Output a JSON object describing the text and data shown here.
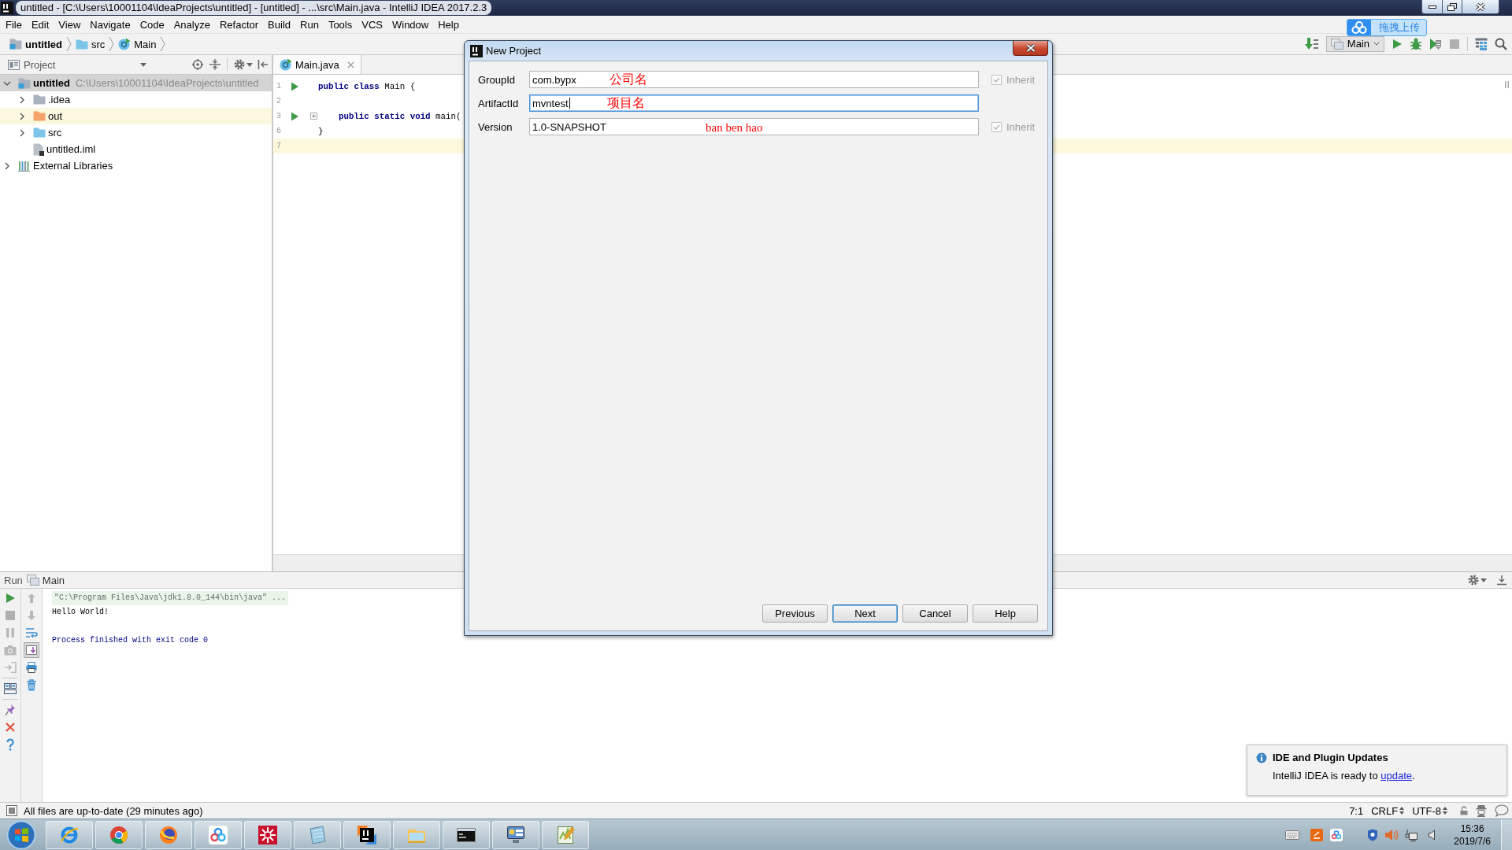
{
  "window": {
    "title": "untitled - [C:\\Users\\10001104\\IdeaProjects\\untitled] - [untitled] - ...\\src\\Main.java - IntelliJ IDEA 2017.2.3"
  },
  "menu": [
    "File",
    "Edit",
    "View",
    "Navigate",
    "Code",
    "Analyze",
    "Refactor",
    "Build",
    "Run",
    "Tools",
    "VCS",
    "Window",
    "Help"
  ],
  "breadcrumb": [
    {
      "label": "untitled",
      "kind": "project"
    },
    {
      "label": "src",
      "kind": "source-folder"
    },
    {
      "label": "Main",
      "kind": "class"
    }
  ],
  "toolbar": {
    "run_config": "Main"
  },
  "upload_widget": {
    "label": "拖拽上传"
  },
  "project_panel": {
    "title": "Project",
    "tree": [
      {
        "label": "untitled",
        "kind": "project",
        "path": "C:\\Users\\10001104\\IdeaProjects\\untitled",
        "expanded": true,
        "selected": true,
        "highlighted": false,
        "children": [
          {
            "label": ".idea",
            "kind": "folder",
            "expanded": false,
            "selected": false,
            "highlighted": false
          },
          {
            "label": "out",
            "kind": "excluded-folder",
            "expanded": false,
            "selected": false,
            "highlighted": true
          },
          {
            "label": "src",
            "kind": "source-folder",
            "expanded": false,
            "selected": false,
            "highlighted": false
          },
          {
            "label": "untitled.iml",
            "kind": "module-file",
            "selected": false,
            "highlighted": false
          }
        ]
      },
      {
        "label": "External Libraries",
        "kind": "libraries",
        "expanded": false,
        "selected": false,
        "highlighted": false
      }
    ]
  },
  "editor": {
    "tabs": [
      {
        "label": "Main.java",
        "selected": true
      }
    ],
    "lines": [
      {
        "number": "1",
        "code": "**public** **class** Main {",
        "run_marker": true,
        "fold_marker": false,
        "current": false
      },
      {
        "number": "2",
        "run_marker": false,
        "fold_marker": false,
        "current": false
      },
      {
        "number": "3",
        "code": "    **public** **static** **void** main(",
        "run_marker": true,
        "fold_marker": true,
        "current": false
      },
      {
        "number": "6",
        "code": "}",
        "run_marker": false,
        "fold_marker": false,
        "current": false
      },
      {
        "number": "7",
        "run_marker": false,
        "fold_marker": false,
        "current": true
      }
    ]
  },
  "dialog": {
    "title": "New Project",
    "fields": [
      {
        "label": "GroupId",
        "value": "com.bypx",
        "focused": false,
        "note": "公司名",
        "inherit": {
          "label": "Inherit",
          "checked": true,
          "disabled": true
        }
      },
      {
        "label": "ArtifactId",
        "value": "mvntest",
        "focused": true,
        "note": "项目名"
      },
      {
        "label": "Version",
        "value": "1.0-SNAPSHOT",
        "focused": false,
        "note": "ban ben hao",
        "inherit": {
          "label": "Inherit",
          "checked": true,
          "disabled": true
        }
      }
    ],
    "buttons": [
      {
        "label": "Previous",
        "default": false
      },
      {
        "label": "Next",
        "default": true
      },
      {
        "label": "Cancel",
        "default": false
      },
      {
        "label": "Help",
        "default": false
      }
    ]
  },
  "run_panel": {
    "title": "Run",
    "tab": "Main",
    "scroll_to_end_on": true,
    "console": [
      {
        "kind": "command",
        "text": "\"C:\\Program Files\\Java\\jdk1.8.0_144\\bin\\java\" ..."
      },
      {
        "kind": "output",
        "text": "Hello World!"
      },
      {
        "kind": "exit",
        "text": "Process finished with exit code 0"
      }
    ]
  },
  "notification": {
    "title": "IDE and Plugin Updates",
    "text_before": "IntelliJ IDEA is ready to ",
    "link": "update",
    "text_after": "."
  },
  "status_bar": {
    "message": "All files are up-to-date (29 minutes ago)",
    "items": [
      {
        "text": "7:1",
        "dropdown": false
      },
      {
        "text": "CRLF",
        "dropdown": true
      },
      {
        "text": "UTF-8",
        "dropdown": true
      }
    ]
  },
  "taskbar": {
    "clock": {
      "time": "15:36",
      "date": "2019/7/6"
    }
  }
}
